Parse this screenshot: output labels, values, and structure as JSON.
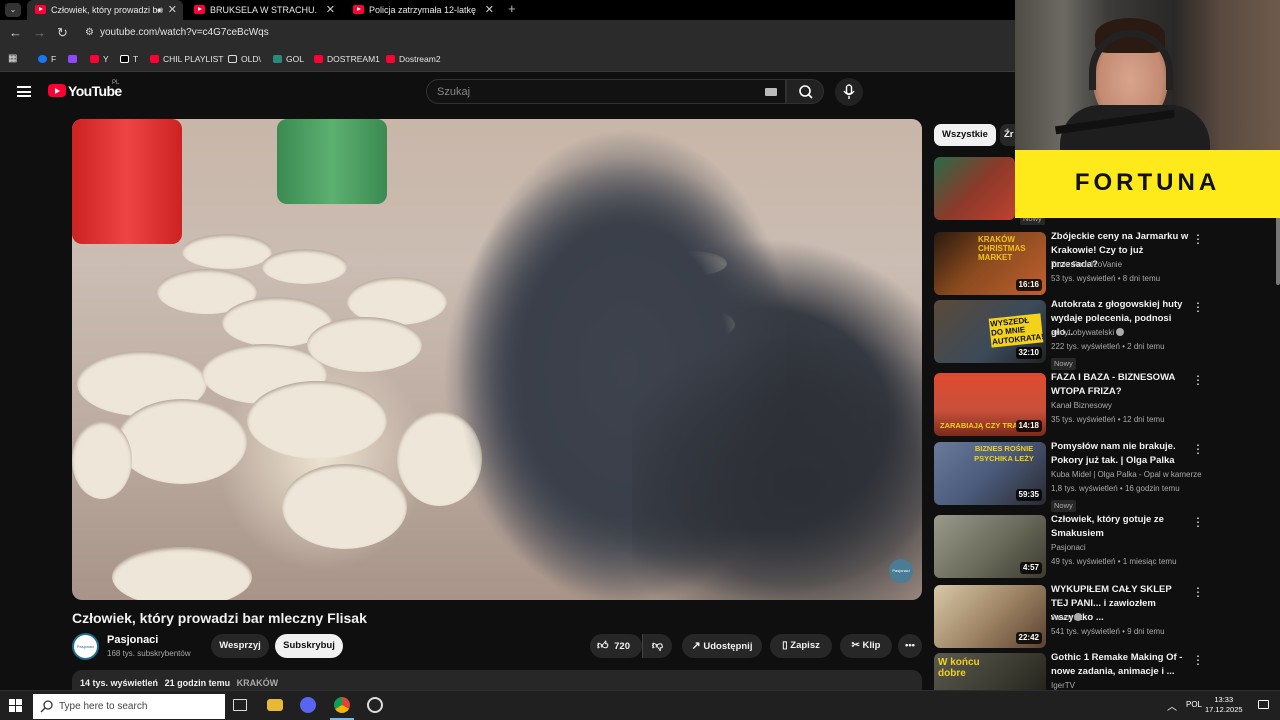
{
  "browser": {
    "tabs": [
      {
        "title": "Człowiek, który prowadzi bar mleczny Flisak - YouTube",
        "active": true
      },
      {
        "title": "BRUKSELA W STRACHU. WOJNA Z ROSJĄ",
        "active": false
      },
      {
        "title": "Policja zatrzymała 12-latkę. Co się stało",
        "active": false
      }
    ],
    "url": "youtube.com/watch?v=c4G7ceBcWqs",
    "bookmarks": [
      "F",
      "",
      "Y",
      "T",
      "CHIL PLAYLIST",
      "OLD\\",
      "GOL",
      "DOSTREAM1",
      "Dostream2"
    ]
  },
  "youtube": {
    "logo_text": "YouTube",
    "logo_country": "PL",
    "search_placeholder": "Szukaj"
  },
  "video": {
    "title": "Człowiek, który prowadzi bar mleczny Flisak",
    "channel": "Pasjonaci",
    "subscribers": "168 tys. subskrybentów",
    "watermark": "Pasjonaci",
    "support_label": "Wesprzyj",
    "subscribe_label": "Subskrybuj",
    "likes": "720",
    "share_label": "Udostępnij",
    "save_label": "Zapisz",
    "clip_label": "Klip",
    "views": "14 tys. wyświetleń",
    "posted": "21 godzin temu",
    "tag": "KRAKÓW"
  },
  "sidebar": {
    "chips": [
      "Wszystkie",
      "Źr"
    ],
    "items": [
      {
        "title": "",
        "channel": "",
        "meta": "",
        "duration": "",
        "badge": "Nowy",
        "thumb": "#7a3a2a"
      },
      {
        "title": "Zbójeckie ceny na Jarmarku w Krakowie! Czy to już przesada?",
        "channel": "Tanie PodróżoVanie",
        "meta": "53 tys. wyświetleń • 8 dni temu",
        "duration": "16:16",
        "badge": "",
        "thumb": "#8a4a1e",
        "overlay": "KRAKÓW CHRISTMAS MARKET"
      },
      {
        "title": "Autokrata z głogowskiej huty wydaje polecenia, podnosi gło...",
        "channel": "audyt obywatelski",
        "meta": "222 tys. wyświetleń • 2 dni temu",
        "duration": "32:10",
        "badge": "Nowy",
        "thumb": "#3b4a5a",
        "overlay": "WYSZEDŁ DO MNIE AUTOKRATA!"
      },
      {
        "title": "FAZA I BAZA - BIZNESOWA WTOPA FRIZA?",
        "channel": "Kanał Biznesowy",
        "meta": "35 tys. wyświetleń • 12 dni temu",
        "duration": "14:18",
        "badge": "",
        "thumb": "#c8503a",
        "overlay": "ZARABIAJĄ CZY TRACĄ"
      },
      {
        "title": "Pomysłów nam nie brakuje. Pokory już tak. | Olga Palka",
        "channel": "Kuba Midel | Olga Palka - Opal w kamerze",
        "meta": "1,8 tys. wyświetleń • 16 godzin temu",
        "duration": "59:35",
        "badge": "Nowy",
        "thumb": "#4a5a7a",
        "overlay": "BIZNES ROŚNIE PSYCHIKA LEŻY"
      },
      {
        "title": "Człowiek, który gotuje ze Smakusiem",
        "channel": "Pasjonaci",
        "meta": "49 tys. wyświetleń • 1 miesiąc temu",
        "duration": "4:57",
        "badge": "",
        "thumb": "#6a6a5a",
        "overlay": ""
      },
      {
        "title": "WYKUPIŁEM CAŁY SKLEP TEJ PANI... i zawiozłem wszystko ...",
        "channel": "Jawor",
        "meta": "541 tys. wyświetleń • 9 dni temu",
        "duration": "22:42",
        "badge": "",
        "thumb": "#9a8060",
        "overlay": ""
      },
      {
        "title": "Gothic 1 Remake  Making Of - nowe zadania, animacje i ...",
        "channel": "IgerTV",
        "meta": "",
        "duration": "",
        "badge": "",
        "thumb": "#3a3a30",
        "overlay": "W końcu dobre"
      }
    ]
  },
  "overlay": {
    "sponsor": "FORTUNA"
  },
  "taskbar": {
    "search_placeholder": "Type here to search",
    "language": "POL",
    "time": "13:33",
    "date": "17.12.2025"
  }
}
